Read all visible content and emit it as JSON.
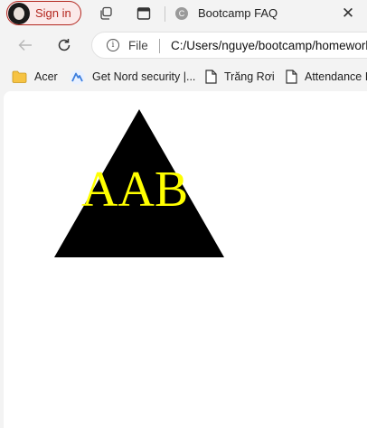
{
  "tabstrip": {
    "signin_label": "Sign in",
    "tab_title": "Bootcamp FAQ",
    "tab_favicon_glyph": "C",
    "close_glyph": "✕"
  },
  "navbar": {
    "file_label": "File",
    "url": "C:/Users/nguye/bootcamp/homework"
  },
  "bookmarks": [
    {
      "label": "Acer",
      "icon": "folder-icon"
    },
    {
      "label": "Get Nord security |...",
      "icon": "nord-icon"
    },
    {
      "label": "Trăng Rơi",
      "icon": "page-icon"
    },
    {
      "label": "Attendance I",
      "icon": "page-icon"
    }
  ],
  "page": {
    "triangle_text": "AAB",
    "triangle_color": "#000000",
    "text_color": "#ffff00"
  }
}
